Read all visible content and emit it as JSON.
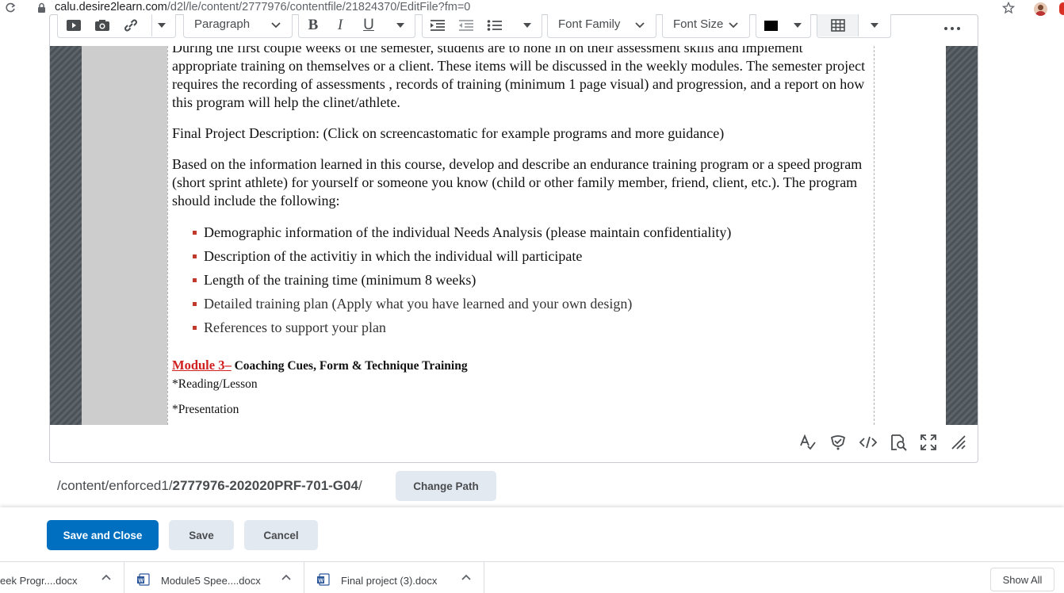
{
  "browser": {
    "url_host": "calu.desire2learn.com",
    "url_path": "/d2l/le/content/2777976/contentfile/21824370/EditFile?fm=0"
  },
  "toolbar": {
    "paragraph_label": "Paragraph",
    "font_family_label": "Font Family",
    "font_size_label": "Font Size",
    "font_color": "#000000"
  },
  "document": {
    "para1": "During the first couple weeks of the semester, students are to hone in on their assessment skills and implement appropriate training on themselves or a client. These items will be discussed in the weekly modules. The semester project requires the recording of assessments , records of training (minimum 1 page visual) and progression, and a report on how this program will help the clinet/athlete.",
    "para2": "Final Project Description: (Click on screencastomatic for example programs and more guidance)",
    "para3": "Based on the information learned in this course, develop and describe an endurance training program or a speed program (short sprint athlete) for yourself or someone you know (child or other family member, friend, client, etc.). The program should include the following:",
    "bullets": [
      "Demographic information of the individual Needs Analysis (please maintain confidentiality)",
      "Description of the activitiy in which the individual will participate",
      "Length of the training time (minimum 8 weeks)",
      "Detailed training plan (Apply what you have learned and your own design)",
      "References to support your plan"
    ],
    "module_link": "Module 3–",
    "module_title": " Coaching Cues, Form & Technique Training",
    "reading": "*Reading/Lesson",
    "presentation": "*Presentation"
  },
  "path": {
    "prefix": "/content/enforced1/",
    "course": "2777976-202020PRF-701-G04",
    "suffix": "/",
    "change_label": "Change Path"
  },
  "actions": {
    "save_close": "Save and Close",
    "save": "Save",
    "cancel": "Cancel"
  },
  "downloads": {
    "items": [
      {
        "name": "eek Progr....docx"
      },
      {
        "name": "Module5 Spee....docx"
      },
      {
        "name": "Final project (3).docx"
      }
    ],
    "show_all": "Show All"
  },
  "colors": {
    "primary": "#006fbf",
    "link_red": "#d0201f",
    "bullet": "#c0392b"
  }
}
